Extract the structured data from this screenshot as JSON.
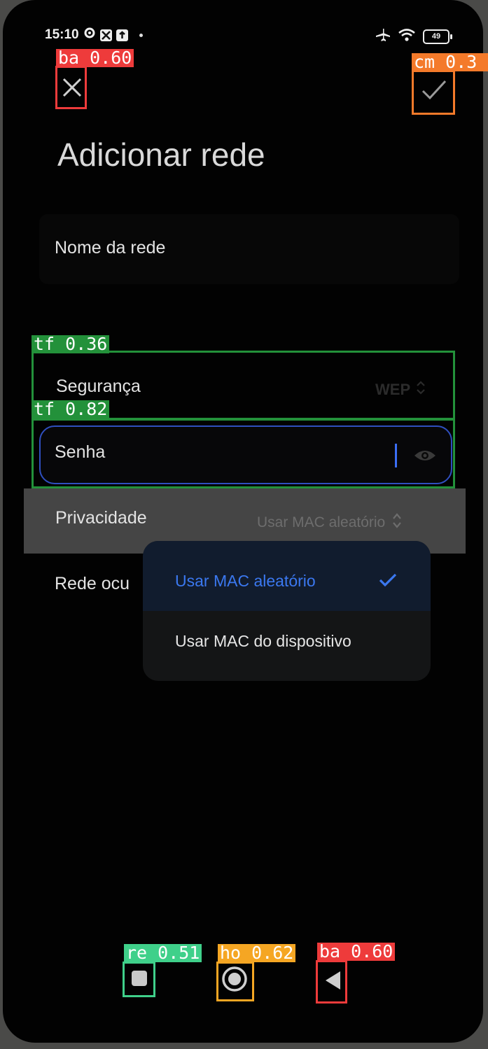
{
  "status_bar": {
    "time": "15:10",
    "battery": "49"
  },
  "header": {
    "title": "Adicionar rede"
  },
  "form": {
    "network_name_label": "Nome da rede",
    "security_label": "Segurança",
    "security_value": "WEP",
    "password_label": "Senha",
    "privacy_label": "Privacidade",
    "privacy_value": "Usar MAC aleatório",
    "hidden_network_label": "Rede ocu"
  },
  "dropdown": {
    "options": [
      {
        "label": "Usar MAC aleatório",
        "selected": true
      },
      {
        "label": "Usar MAC do dispositivo",
        "selected": false
      }
    ]
  },
  "detections": {
    "close": "ba 0.60",
    "confirm": "cm 0.3",
    "security_field": "tf 0.36",
    "password_field": "tf 0.82",
    "recents": "re 0.51",
    "home": "ho 0.62",
    "back": "ba 0.60"
  },
  "colors": {
    "accent": "#3b6ef5",
    "det_red": "#ee3b3b",
    "det_orange": "#f47a2a",
    "det_green": "#23913a",
    "det_mint": "#3fd08a",
    "det_amber": "#f5a623"
  }
}
